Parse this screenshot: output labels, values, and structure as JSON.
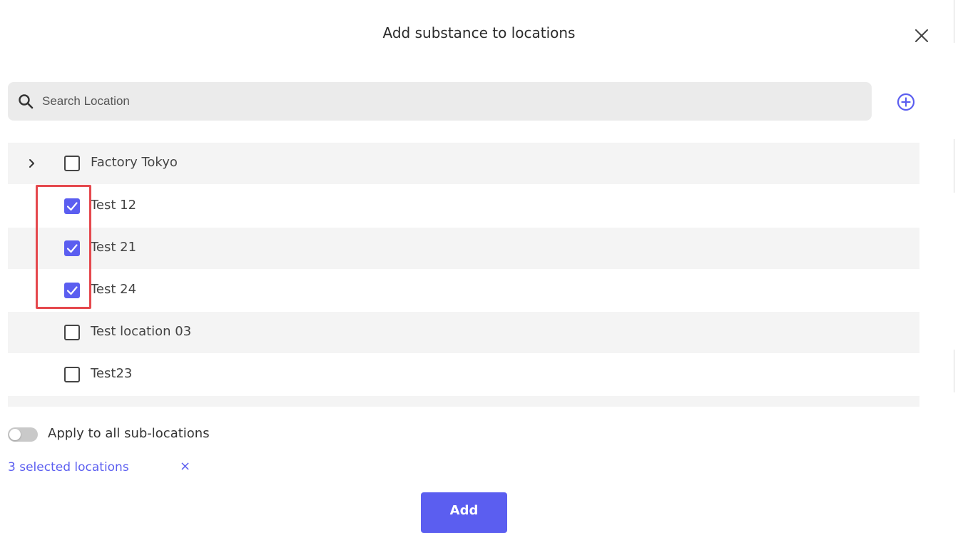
{
  "dialog": {
    "title": "Add substance to locations",
    "close_icon": "close-icon"
  },
  "search": {
    "placeholder": "Search Location",
    "value": "",
    "icon": "search-icon"
  },
  "add_location_icon": "plus-circle-icon",
  "locations": [
    {
      "label": "Factory Tokyo",
      "checked": false,
      "expandable": true,
      "shaded": true
    },
    {
      "label": "Test 12",
      "checked": true,
      "expandable": false,
      "shaded": false
    },
    {
      "label": "Test 21",
      "checked": true,
      "expandable": false,
      "shaded": true
    },
    {
      "label": "Test 24",
      "checked": true,
      "expandable": false,
      "shaded": false
    },
    {
      "label": "Test location 03",
      "checked": false,
      "expandable": false,
      "shaded": true
    },
    {
      "label": "Test23",
      "checked": false,
      "expandable": false,
      "shaded": false
    },
    {
      "label": "",
      "checked": false,
      "expandable": false,
      "shaded": true
    }
  ],
  "apply_sub_locations": {
    "label": "Apply to all sub-locations",
    "enabled": false
  },
  "selection": {
    "count_text": "3 selected locations",
    "clear_label": "×"
  },
  "add_button_label": "Add",
  "colors": {
    "accent": "#5b5ef0",
    "highlight": "#e5484d",
    "row_shade": "#f4f4f4",
    "search_bg": "#ebebeb"
  }
}
